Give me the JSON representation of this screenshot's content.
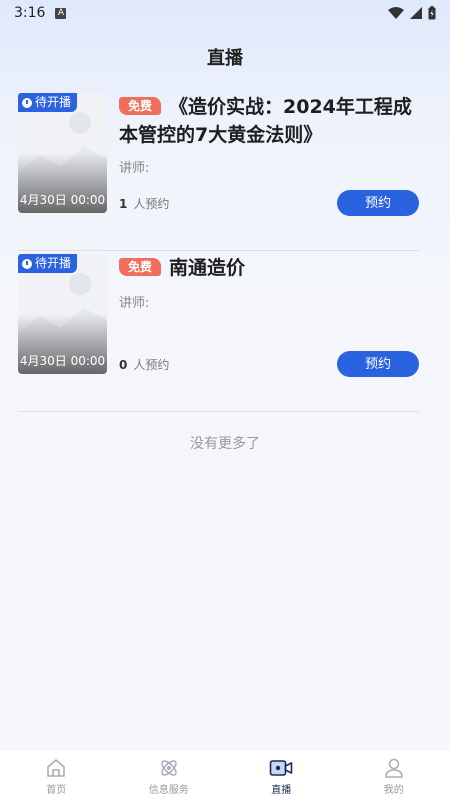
{
  "status_bar": {
    "time": "3:16",
    "a_icon": "A"
  },
  "page": {
    "title": "直播"
  },
  "items": [
    {
      "status_badge": "待开播",
      "time": "4月30日 00:00",
      "free_tag": "免费",
      "title": "《造价实战：2024年工程成本管控的7大黄金法则》",
      "teacher_label": "讲师:",
      "reservations": "1",
      "reservations_label": "人预约",
      "button": "预约"
    },
    {
      "status_badge": "待开播",
      "time": "4月30日 00:00",
      "free_tag": "免费",
      "title": "南通造价",
      "teacher_label": "讲师:",
      "reservations": "0",
      "reservations_label": "人预约",
      "button": "预约"
    }
  ],
  "footer_text": "没有更多了",
  "tabs": [
    {
      "label": "首页",
      "icon": "home-icon",
      "active": false
    },
    {
      "label": "信息服务",
      "icon": "info-service-icon",
      "active": false
    },
    {
      "label": "直播",
      "icon": "live-video-icon",
      "active": true
    },
    {
      "label": "我的",
      "icon": "profile-icon",
      "active": false
    }
  ],
  "colors": {
    "primary": "#2a62e0",
    "free": "#f16e5a",
    "tab_active": "#1b2b55"
  }
}
